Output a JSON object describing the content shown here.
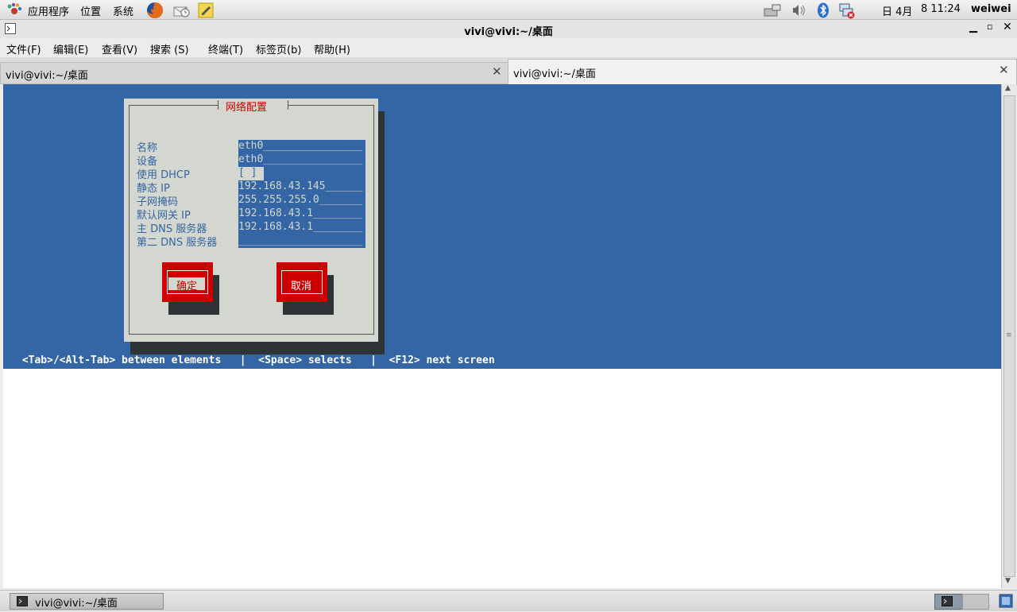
{
  "top_panel": {
    "applications": "应用程序",
    "places": "位置",
    "system": "系统",
    "date": "日 4月",
    "time": "8 11:24",
    "user": "weiwei"
  },
  "window": {
    "title": "vivi@vivi:~/桌面"
  },
  "menu": {
    "file": "文件(F)",
    "edit": "编辑(E)",
    "view": "查看(V)",
    "search": "搜索 (S)",
    "terminal": "终端(T)",
    "tabs": "标签页(b)",
    "help": "帮助(H)"
  },
  "tabs": [
    {
      "label": "vivi@vivi:~/桌面"
    },
    {
      "label": "vivi@vivi:~/桌面"
    }
  ],
  "dialog": {
    "title": "网络配置",
    "fields": [
      {
        "label": "名称",
        "value": "eth0________________"
      },
      {
        "label": "设备",
        "value": "eth0________________"
      },
      {
        "label": "使用 DHCP",
        "value": "[ ]"
      },
      {
        "label": "静态 IP",
        "value": "192.168.43.145______"
      },
      {
        "label": "子网掩码",
        "value": "255.255.255.0_______"
      },
      {
        "label": "默认网关 IP",
        "value": "192.168.43.1________"
      },
      {
        "label": "主 DNS 服务器",
        "value": "192.168.43.1________"
      },
      {
        "label": "第二 DNS 服务器",
        "value": "____________________"
      }
    ],
    "ok_label": "确定",
    "cancel_label": "取消"
  },
  "status_line": " <Tab>/<Alt-Tab> between elements   |  <Space> selects   |  <F12> next screen",
  "taskbar": {
    "task_label": "vivi@vivi:~/桌面"
  },
  "colors": {
    "terminal_bg": "#3465a4",
    "dialog_bg": "#d3d7cf",
    "button_red": "#cc0000"
  }
}
